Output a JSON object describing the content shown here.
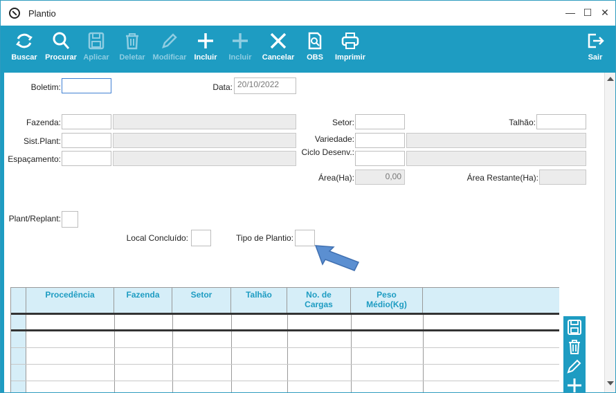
{
  "window": {
    "title": "Plantio"
  },
  "toolbar": [
    {
      "label": "Buscar",
      "icon": "refresh-icon",
      "enabled": true
    },
    {
      "label": "Procurar",
      "icon": "search-icon",
      "enabled": true
    },
    {
      "label": "Aplicar",
      "icon": "save-icon",
      "enabled": false
    },
    {
      "label": "Deletar",
      "icon": "trash-icon",
      "enabled": false
    },
    {
      "label": "Modificar",
      "icon": "pencil-icon",
      "enabled": false
    },
    {
      "label": "Incluir",
      "icon": "plus-icon",
      "enabled": true
    },
    {
      "label": "Incluir",
      "icon": "plus-icon",
      "enabled": false
    },
    {
      "label": "Cancelar",
      "icon": "close-icon",
      "enabled": true
    },
    {
      "label": "OBS",
      "icon": "document-search-icon",
      "enabled": true
    },
    {
      "label": "Imprimir",
      "icon": "printer-icon",
      "enabled": true
    }
  ],
  "exit": {
    "label": "Sair",
    "icon": "exit-icon"
  },
  "form": {
    "boletim": {
      "label": "Boletim:",
      "value": ""
    },
    "data": {
      "label": "Data:",
      "value": "20/10/2022"
    },
    "fazenda": {
      "label": "Fazenda:",
      "value": "",
      "desc": ""
    },
    "sist_plant": {
      "label": "Sist.Plant:",
      "value": "",
      "desc": ""
    },
    "espacamento": {
      "label": "Espaçamento:",
      "value": "",
      "desc": ""
    },
    "setor": {
      "label": "Setor:",
      "value": ""
    },
    "talhao": {
      "label": "Talhão:",
      "value": ""
    },
    "variedade": {
      "label": "Variedade:",
      "value": "",
      "desc": ""
    },
    "ciclo": {
      "label": "Ciclo Desenv.:",
      "value": "",
      "desc": ""
    },
    "area": {
      "label": "Área(Ha):",
      "value": "0,00"
    },
    "area_restante": {
      "label": "Área Restante(Ha):",
      "value": ""
    },
    "plant_replant": {
      "label": "Plant/Replant:",
      "value": ""
    },
    "local_concluido": {
      "label": "Local Concluído:",
      "value": ""
    },
    "tipo_plantio": {
      "label": "Tipo de Plantio:",
      "value": ""
    }
  },
  "grid": {
    "columns": [
      "Procedência",
      "Fazenda",
      "Setor",
      "Talhão",
      "No. de\nCargas",
      "Peso\nMédio(Kg)",
      ""
    ],
    "rows": 5
  },
  "side_buttons": [
    "save-icon",
    "trash-icon",
    "pencil-icon",
    "plus-icon"
  ],
  "colors": {
    "accent": "#1e9cc2",
    "arrow": "#5b8fd1"
  }
}
